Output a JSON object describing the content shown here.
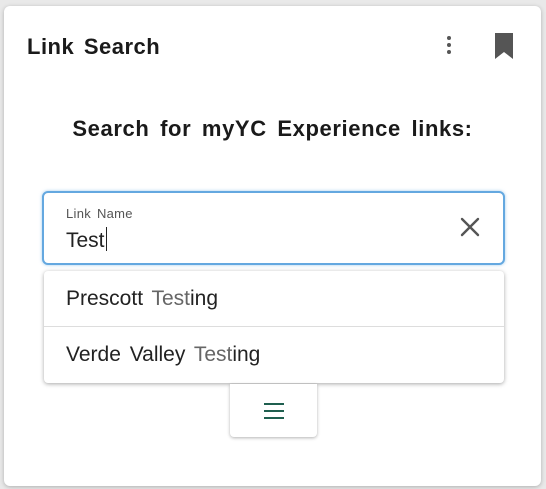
{
  "card": {
    "title": "Link Search",
    "menu_icon": "more-vert-icon",
    "bookmark_icon": "bookmark-icon"
  },
  "search": {
    "heading": "Search for myYC Experience links:",
    "field_label": "Link Name",
    "value": "Test",
    "clear_icon": "close-icon"
  },
  "suggestions": [
    {
      "prefix": "Prescott ",
      "match": "Test",
      "suffix": "ing"
    },
    {
      "prefix": "Verde Valley ",
      "match": "Test",
      "suffix": "ing"
    }
  ],
  "menu_button": {
    "icon": "hamburger-icon"
  },
  "colors": {
    "focus_border": "#64a8e0",
    "menu_icon_color": "#1f5f4f",
    "match_text": "#666666"
  }
}
